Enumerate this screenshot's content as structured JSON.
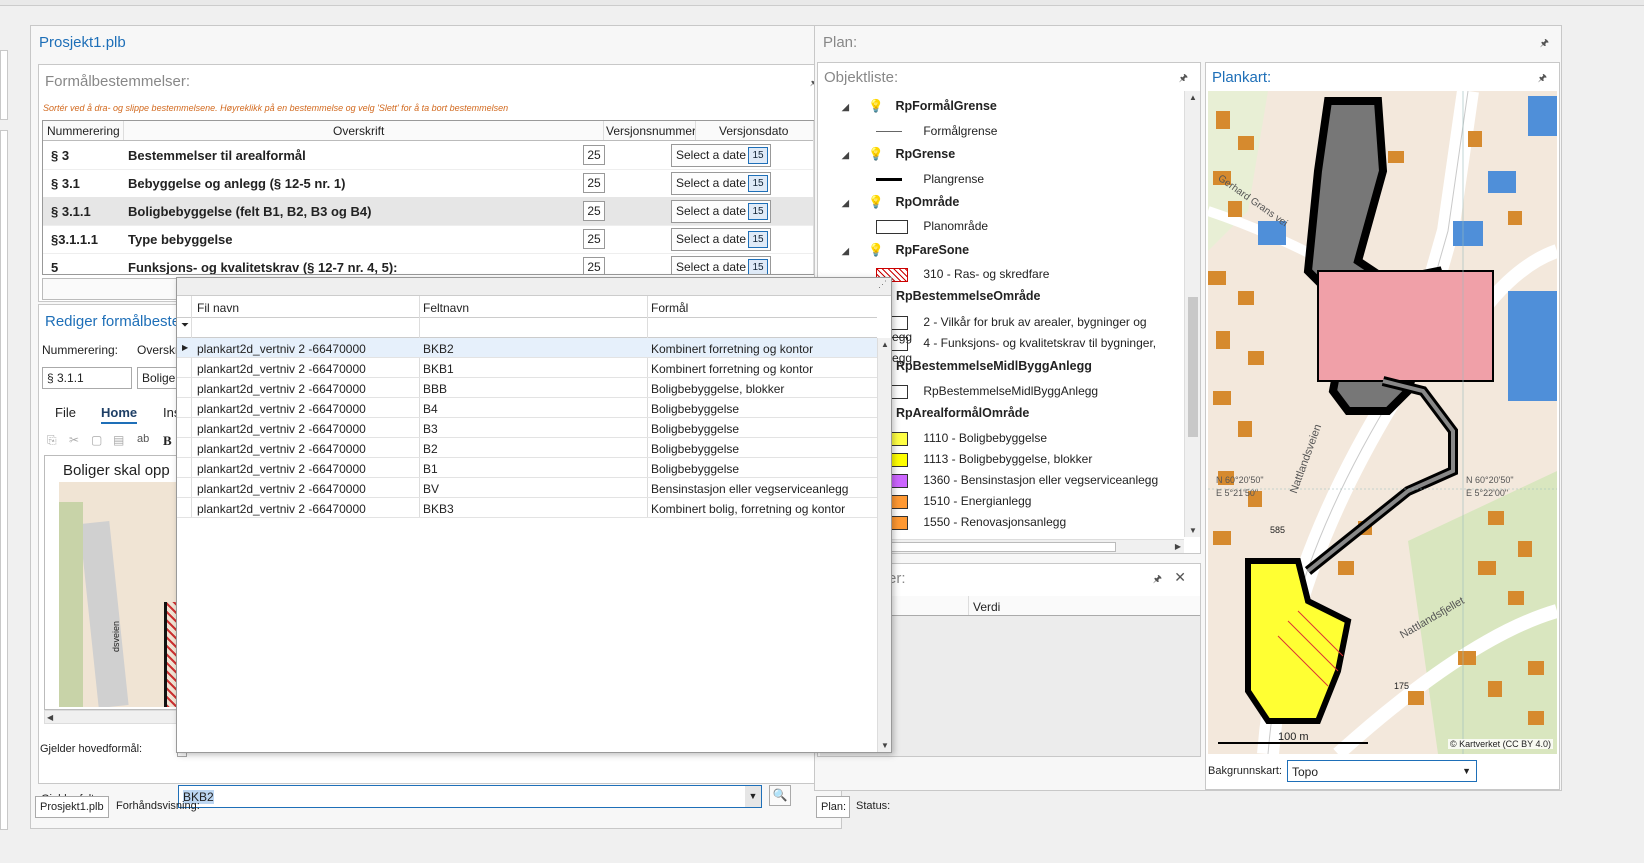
{
  "project": {
    "title": "Prosjekt1.plb",
    "pin": "⊓"
  },
  "formal": {
    "title": "Formålbestemmelser:",
    "hint": "Sortér ved å dra- og slippe bestemmelsene. Høyreklikk på en bestemmelse og velg 'Slett' for å ta bort bestemmelsen",
    "columns": [
      "Nummerering",
      "Overskrift",
      "Versjonsnummer",
      "Versjonsdato"
    ],
    "rows": [
      {
        "num": "§ 3",
        "title": "Bestemmelser til arealformål",
        "ver": "25",
        "date": "Select a date"
      },
      {
        "num": "§ 3.1",
        "title": "Bebyggelse og anlegg (§ 12-5 nr. 1)",
        "ver": "25",
        "date": "Select a date"
      },
      {
        "num": "§ 3.1.1",
        "title": "Boligbebyggelse (felt B1, B2, B3 og B4)",
        "ver": "25",
        "date": "Select a date"
      },
      {
        "num": "§3.1.1.1",
        "title": "Type bebyggelse",
        "ver": "25",
        "date": "Select a date"
      },
      {
        "num": "5",
        "title": "Funksjons- og kvalitetskrav (§ 12-7 nr. 4, 5):",
        "ver": "25",
        "date": "Select a date"
      }
    ],
    "cal_label": "15"
  },
  "edit": {
    "title": "Rediger formålbeste",
    "num_label": "Nummerering:",
    "over_label": "Overskri",
    "num_value": "§ 3.1.1",
    "over_value": "Bolige",
    "ribbon_tabs": [
      "File",
      "Home",
      "Ins"
    ],
    "bold": "B",
    "doc_text": "Boliger skal opp",
    "map_label": "dsveien",
    "hoved_label": "Gjelder hovedformål:",
    "felt_label": "Gjelder felt:",
    "felt_value": "BKB2"
  },
  "bottom_tabs": {
    "left": [
      "Prosjekt1.plb",
      "Forhåndsvisning:"
    ],
    "right": [
      "Plan:",
      "Status:"
    ]
  },
  "popup": {
    "columns": [
      "Fil navn",
      "Feltnavn",
      "Formål"
    ],
    "rows": [
      {
        "fil": "plankart2d_vertniv 2 -66470000",
        "felt": "BKB2",
        "formal": "Kombinert forretning og kontor"
      },
      {
        "fil": "plankart2d_vertniv 2 -66470000",
        "felt": "BKB1",
        "formal": "Kombinert forretning og kontor"
      },
      {
        "fil": "plankart2d_vertniv 2 -66470000",
        "felt": "BBB",
        "formal": "Boligbebyggelse, blokker"
      },
      {
        "fil": "plankart2d_vertniv 2 -66470000",
        "felt": "B4",
        "formal": "Boligbebyggelse"
      },
      {
        "fil": "plankart2d_vertniv 2 -66470000",
        "felt": "B3",
        "formal": "Boligbebyggelse"
      },
      {
        "fil": "plankart2d_vertniv 2 -66470000",
        "felt": "B2",
        "formal": "Boligbebyggelse"
      },
      {
        "fil": "plankart2d_vertniv 2 -66470000",
        "felt": "B1",
        "formal": "Boligbebyggelse"
      },
      {
        "fil": "plankart2d_vertniv 2 -66470000",
        "felt": "BV",
        "formal": "Bensinstasjon eller vegserviceanlegg"
      },
      {
        "fil": "plankart2d_vertniv 2 -66470000",
        "felt": "BKB3",
        "formal": "Kombinert bolig, forretning og kontor"
      }
    ]
  },
  "plan": {
    "title": "Plan:"
  },
  "objekt": {
    "title": "Objektliste:",
    "items": [
      {
        "type": "group",
        "label": "RpFormålGrense"
      },
      {
        "type": "item",
        "label": "Formålgrense",
        "swatch": "thin-line"
      },
      {
        "type": "group",
        "label": "RpGrense"
      },
      {
        "type": "item",
        "label": "Plangrense",
        "swatch": "thick-line"
      },
      {
        "type": "group",
        "label": "RpOmråde"
      },
      {
        "type": "item",
        "label": "Planområde",
        "swatch": "box"
      },
      {
        "type": "group",
        "label": "RpFareSone"
      },
      {
        "type": "item",
        "label": "310 - Ras- og skredfare",
        "swatch": "hatch"
      },
      {
        "type": "group2",
        "label": "RpBestemmelseOmråde"
      },
      {
        "type": "item",
        "label": "2 - Vilkår for bruk av arealer, bygninger og anlegg",
        "swatch": "box"
      },
      {
        "type": "item",
        "label": "4 - Funksjons- og kvalitetskrav til bygninger, anlegg",
        "swatch": "box"
      },
      {
        "type": "group2",
        "label": "RpBestemmelseMidlByggAnlegg"
      },
      {
        "type": "item",
        "label": "RpBestemmelseMidlByggAnlegg",
        "swatch": "box"
      },
      {
        "type": "group2",
        "label": "RpArealformålOmråde"
      },
      {
        "type": "item",
        "label": "1110 - Boligbebyggelse",
        "swatch": "#ffff44"
      },
      {
        "type": "item",
        "label": "1113 - Boligbebyggelse, blokker",
        "swatch": "#ffff00"
      },
      {
        "type": "item",
        "label": "1360 - Bensinstasjon eller vegserviceanlegg",
        "swatch": "#cc66ff"
      },
      {
        "type": "item",
        "label": "1510 - Energianlegg",
        "swatch": "#ff9933"
      },
      {
        "type": "item",
        "label": "1550 - Renovasjonsanlegg",
        "swatch": "#ff9933"
      }
    ]
  },
  "props": {
    "title": "er:",
    "col_value": "Verdi"
  },
  "plankart": {
    "title": "Plankart:",
    "copyright": "© Kartverket (CC BY 4.0)",
    "scale": "100 m",
    "bg_label": "Bakgrunnskart:",
    "bg_value": "Topo",
    "labels": [
      "Gerhard Grans vei",
      "Nattlandsveien",
      "Nattlandsfjellet",
      "585",
      "175"
    ],
    "coords": [
      "N 60°20'50\"",
      "E 5°21'50\"",
      "N 60°20'50\"",
      "E 5°22'00\""
    ]
  },
  "colors": {
    "accent": "#1e6fb8",
    "map_bg": "#f3e8dc",
    "building": "#d68a2e",
    "pink": "#f0a0a8"
  }
}
